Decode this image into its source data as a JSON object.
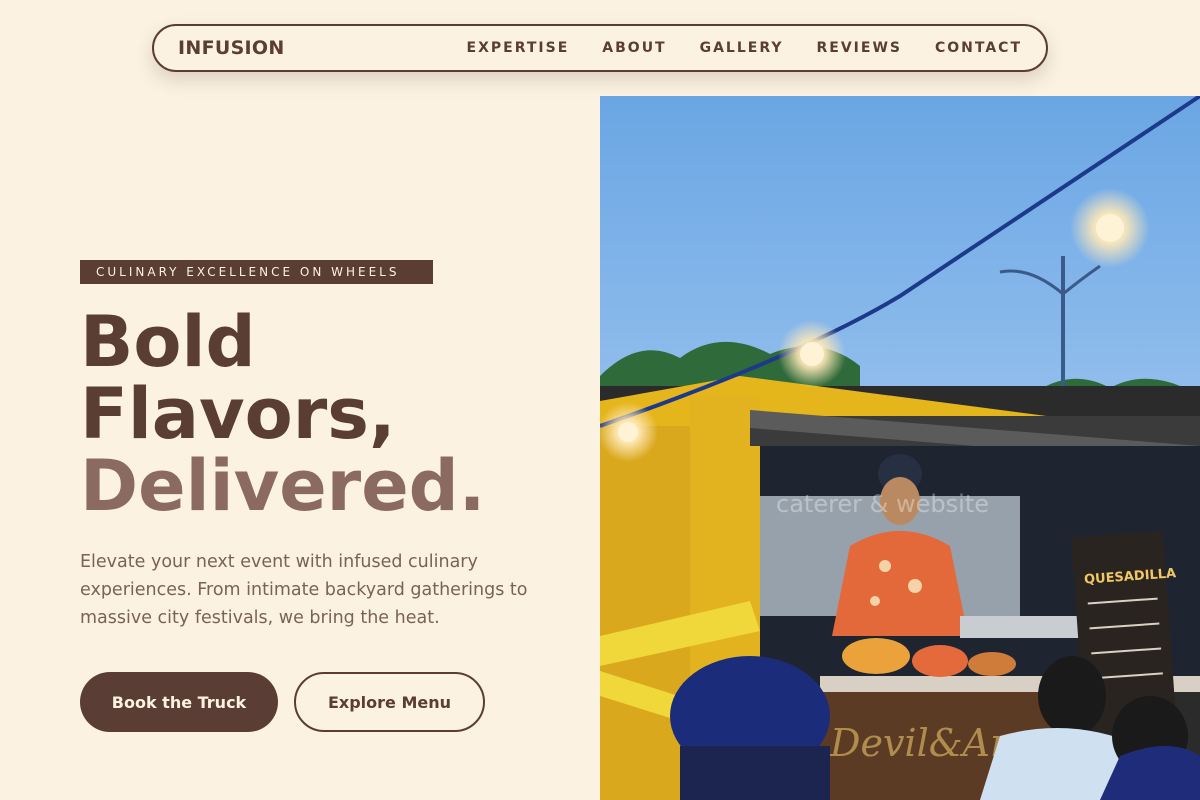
{
  "nav": {
    "brand": "INFUSION",
    "links": [
      "EXPERTISE",
      "ABOUT",
      "GALLERY",
      "REVIEWS",
      "CONTACT"
    ]
  },
  "hero": {
    "badge": "CULINARY EXCELLENCE ON WHEELS",
    "headline_line1": "Bold",
    "headline_line2": "Flavors,",
    "headline_accent": "Delivered.",
    "lead": "Elevate your next event with infused culinary experiences. From intimate backyard gatherings to massive city festivals, we bring the heat.",
    "primary_cta": "Book the Truck",
    "secondary_cta": "Explore Menu"
  },
  "photo": {
    "watermark": "caterer & website",
    "truck_sign": "Devil&Angel",
    "menu_board_title": "QUESADILLA"
  },
  "colors": {
    "background": "#fbf2e1",
    "brown": "#5a3d34",
    "muted_brown": "#8b6a60",
    "text_muted": "#7a625a"
  }
}
